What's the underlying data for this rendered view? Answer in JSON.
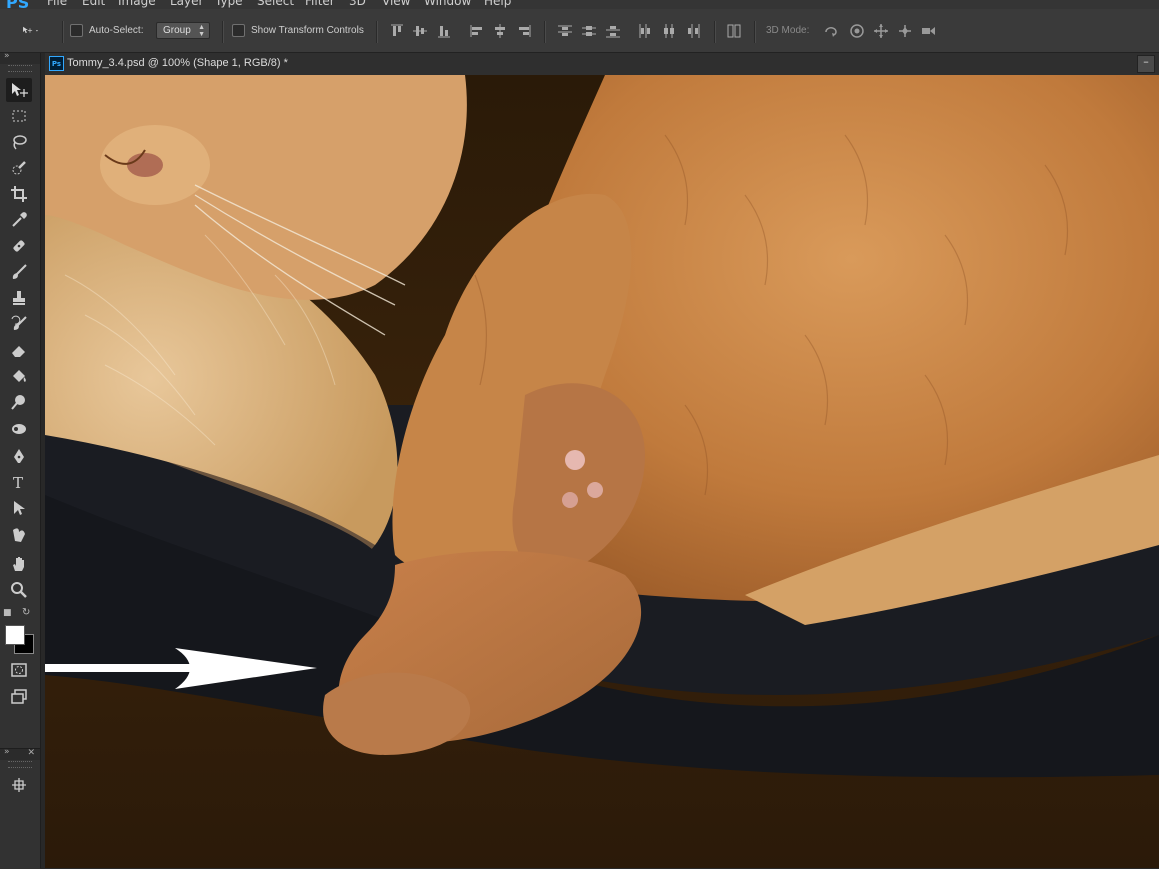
{
  "app": {
    "logo": "PS"
  },
  "menu": [
    "File",
    "Edit",
    "Image",
    "Layer",
    "Type",
    "Select",
    "Filter",
    "3D",
    "View",
    "Window",
    "Help"
  ],
  "options_bar": {
    "auto_select_label": "Auto-Select:",
    "auto_select_value": "Group",
    "show_transform_label": "Show Transform Controls",
    "mode_3d_label": "3D Mode:"
  },
  "document": {
    "tab_title": "Tommy_3.4.psd @ 100% (Shape 1, RGB/8) *",
    "ps_badge": "Ps"
  },
  "tools": [
    "move-tool-icon",
    "marquee-tool-icon",
    "lasso-tool-icon",
    "quick-selection-tool-icon",
    "crop-tool-icon",
    "eyedropper-tool-icon",
    "healing-brush-tool-icon",
    "brush-tool-icon",
    "clone-stamp-tool-icon",
    "history-brush-tool-icon",
    "eraser-tool-icon",
    "paint-bucket-tool-icon",
    "dodge-tool-icon",
    "blur-tool-icon",
    "pen-tool-icon",
    "type-tool-icon",
    "path-selection-tool-icon",
    "custom-shape-tool-icon",
    "hand-tool-icon",
    "zoom-tool-icon"
  ],
  "colors": {
    "foreground": "#ffffff",
    "background": "#000000",
    "accent": "#31a8ff"
  }
}
